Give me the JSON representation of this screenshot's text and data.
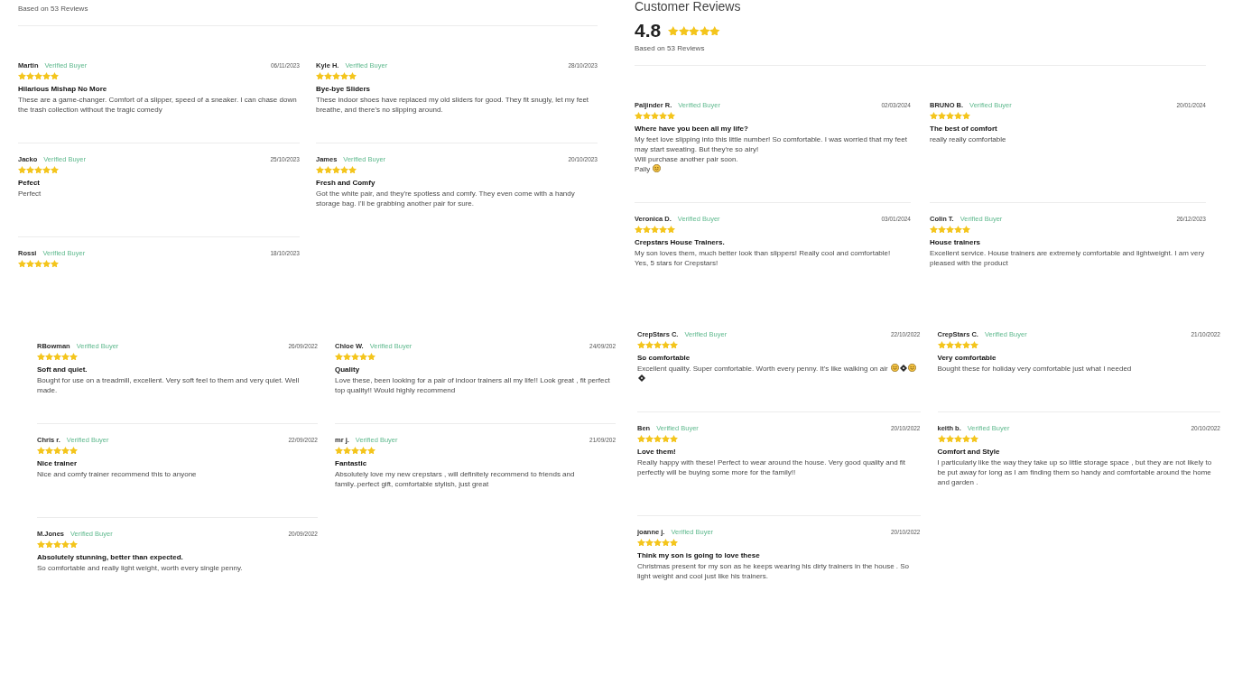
{
  "panels": [
    {
      "based_on": "Based on 53 Reviews",
      "reviews": [
        {
          "name": "Martin",
          "badge": "Verified Buyer",
          "date": "06/11/2023",
          "stars": 5,
          "title": "Hilarious Mishap No More",
          "body": "These are a game-changer. Comfort of a slipper, speed of a sneaker. I can chase down the trash collection without the tragic comedy"
        },
        {
          "name": "Kyle H.",
          "badge": "Verified Buyer",
          "date": "28/10/2023",
          "stars": 5,
          "title": "Bye-bye Sliders",
          "body": "These indoor shoes have replaced my old sliders for good. They fit snugly, let my feet breathe, and there's no slipping around."
        },
        {
          "name": "Jacko",
          "badge": "Verified Buyer",
          "date": "25/10/2023",
          "stars": 5,
          "title": "Pefect",
          "body": "Perfect"
        },
        {
          "name": "James",
          "badge": "Verified Buyer",
          "date": "20/10/2023",
          "stars": 5,
          "title": "Fresh and Comfy",
          "body": "Got the white pair, and they're spotless and comfy. They even come with a handy storage bag. I'll be grabbing another pair for sure."
        },
        {
          "name": "Rossi",
          "badge": "Verified Buyer",
          "date": "18/10/2023",
          "stars": 5
        }
      ]
    },
    {
      "title": "Customer Reviews",
      "rating": "4.8",
      "stars": 5,
      "based_on": "Based on 53 Reviews",
      "reviews": [
        {
          "name": "Paljinder R.",
          "badge": "Verified Buyer",
          "date": "02/03/2024",
          "stars": 5,
          "title": "Where have you been all my life?",
          "body": [
            {
              "kind": "text",
              "text": "My feet love slipping into this little number! So comfortable. I was worried that my feet may start sweating. But they're so airy!\nWill purchase another pair soon."
            },
            {
              "kind": "line_break"
            },
            {
              "kind": "text",
              "text": "Pally"
            },
            {
              "kind": "emoji"
            }
          ]
        },
        {
          "name": "BRUNO B.",
          "badge": "Verified Buyer",
          "date": "20/01/2024",
          "stars": 5,
          "title": "The best of comfort",
          "body": "really really comfortable"
        },
        {
          "name": "Veronica D.",
          "badge": "Verified Buyer",
          "date": "03/01/2024",
          "stars": 5,
          "title": "Crepstars House Trainers.",
          "body": "My son loves them, much better look than slippers! Really cool and comfortable!\nYes, 5 stars for Crepstars!"
        },
        {
          "name": "Colin T.",
          "badge": "Verified Buyer",
          "date": "26/12/2023",
          "stars": 5,
          "title": "House trainers",
          "body": "Excellent service. House trainers are extremely comfortable and lightweight. I am very pleased with the product"
        }
      ]
    },
    {
      "reviews": [
        {
          "name": "RBowman",
          "badge": "Verified Buyer",
          "date": "26/09/2022",
          "stars": 5,
          "title": "Soft and quiet.",
          "body": "Bought for use on a treadmill, excellent. Very soft feel to them and very quiet. Well made."
        },
        {
          "name": "Chloe W.",
          "badge": "Verified Buyer",
          "date": "24/09/202",
          "stars": 5,
          "title": "Quality",
          "body": "Love these, been looking for a pair of indoor trainers all my life!! Look great , fit perfect top quality!! Would highly recommend"
        },
        {
          "name": "Chris r.",
          "badge": "Verified Buyer",
          "date": "22/09/2022",
          "stars": 5,
          "title": "Nice trainer",
          "body": "Nice and comfy trainer recommend this to anyone"
        },
        {
          "name": "mr j.",
          "badge": "Verified Buyer",
          "date": "21/09/202",
          "stars": 5,
          "title": "Fantastic",
          "body": "Absolutely love my new crepstars , will definitely recommend to friends and family..perfect gift, comfortable stylish, just great"
        },
        {
          "name": "M.Jones",
          "badge": "Verified Buyer",
          "date": "20/09/2022",
          "stars": 5,
          "title": "Absolutely stunning, better than expected.",
          "body": "So comfortable and really light weight, worth every single penny."
        }
      ]
    },
    {
      "reviews": [
        {
          "name": "CrepStars C.",
          "badge": "Verified Buyer",
          "date": "22/10/2022",
          "stars": 5,
          "title": "So comfortable",
          "body": [
            {
              "kind": "text",
              "text": "Excellent quality. Super comfortable. Worth every penny. It's like walking on air"
            },
            {
              "kind": "emoji"
            },
            {
              "kind": "unknown_glyph"
            },
            {
              "kind": "emoji"
            },
            {
              "kind": "line_break"
            },
            {
              "kind": "unknown_glyph"
            }
          ]
        },
        {
          "name": "CrepStars C.",
          "badge": "Verified Buyer",
          "date": "21/10/2022",
          "stars": 5,
          "title": "Very comfortable",
          "body": "Bought these for holiday very comfortable just what I needed"
        },
        {
          "name": "Ben",
          "badge": "Verified Buyer",
          "date": "20/10/2022",
          "stars": 5,
          "title": "Love them!",
          "body": "Really happy with these! Perfect to wear around the house. Very good quality and fit perfectly will be buying some more for the family!!"
        },
        {
          "name": "keith b.",
          "badge": "Verified Buyer",
          "date": "20/10/2022",
          "stars": 5,
          "title": "Comfort and Style",
          "body": "I particularly like the way they take up so little storage space , but they are not likely to be put away for long as I am finding them so handy and comfortable around the home and garden ."
        },
        {
          "name": "joanne j.",
          "badge": "Verified Buyer",
          "date": "20/10/2022",
          "stars": 5,
          "title": "Think my son is going to love these",
          "body": "Christmas present for my son as he keeps wearing his dirty trainers in the house . So light weight and cool just like his trainers."
        }
      ]
    }
  ]
}
